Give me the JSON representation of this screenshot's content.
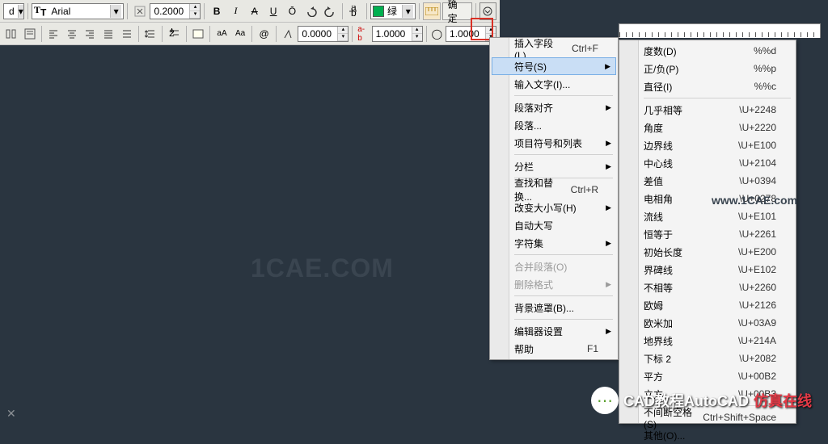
{
  "toolbar1": {
    "font_prefix": "d",
    "font": "Arial",
    "size": "0.2000",
    "bold": "B",
    "italic": "I",
    "strike": "A",
    "underline": "U",
    "overline": "Ō",
    "color_label": "绿",
    "ok": "确定"
  },
  "toolbar2": {
    "num1": "0.0000",
    "ab": "a-b",
    "num2": "1.0000",
    "num3": "1.0000"
  },
  "menu1": [
    {
      "label": "插入字段(L)...",
      "sc": "Ctrl+F"
    },
    {
      "label": "符号(S)",
      "arrow": true,
      "hl": true
    },
    {
      "label": "输入文字(I)..."
    },
    {
      "sep": true
    },
    {
      "label": "段落对齐",
      "arrow": true
    },
    {
      "label": "段落..."
    },
    {
      "label": "项目符号和列表",
      "arrow": true
    },
    {
      "sep": true
    },
    {
      "label": "分栏",
      "arrow": true
    },
    {
      "sep": true
    },
    {
      "label": "查找和替换...",
      "sc": "Ctrl+R"
    },
    {
      "label": "改变大小写(H)",
      "arrow": true
    },
    {
      "label": "自动大写"
    },
    {
      "label": "字符集",
      "arrow": true
    },
    {
      "sep": true
    },
    {
      "label": "合并段落(O)",
      "disabled": true
    },
    {
      "label": "删除格式",
      "arrow": true,
      "disabled": true
    },
    {
      "sep": true
    },
    {
      "label": "背景遮罩(B)..."
    },
    {
      "sep": true
    },
    {
      "label": "编辑器设置",
      "arrow": true
    },
    {
      "label": "帮助",
      "sc": "F1"
    }
  ],
  "menu2": [
    {
      "label": "度数(D)",
      "sc": "%%d"
    },
    {
      "label": "正/负(P)",
      "sc": "%%p"
    },
    {
      "label": "直径(I)",
      "sc": "%%c"
    },
    {
      "sep": true
    },
    {
      "label": "几乎相等",
      "sc": "\\U+2248"
    },
    {
      "label": "角度",
      "sc": "\\U+2220"
    },
    {
      "label": "边界线",
      "sc": "\\U+E100"
    },
    {
      "label": "中心线",
      "sc": "\\U+2104"
    },
    {
      "label": "差值",
      "sc": "\\U+0394"
    },
    {
      "label": "电相角",
      "sc": "\\U+0278"
    },
    {
      "label": "流线",
      "sc": "\\U+E101"
    },
    {
      "label": "恒等于",
      "sc": "\\U+2261"
    },
    {
      "label": "初始长度",
      "sc": "\\U+E200"
    },
    {
      "label": "界碑线",
      "sc": "\\U+E102"
    },
    {
      "label": "不相等",
      "sc": "\\U+2260"
    },
    {
      "label": "欧姆",
      "sc": "\\U+2126"
    },
    {
      "label": "欧米加",
      "sc": "\\U+03A9"
    },
    {
      "label": "地界线",
      "sc": "\\U+214A"
    },
    {
      "label": "下标 2",
      "sc": "\\U+2082"
    },
    {
      "label": "平方",
      "sc": "\\U+00B2"
    },
    {
      "label": "立方",
      "sc": "\\U+00B3"
    },
    {
      "sep": true
    },
    {
      "label": "不间断空格(S)",
      "sc": "Ctrl+Shift+Space"
    },
    {
      "label": "其他(O)..."
    }
  ],
  "watermark1": "1CAE.COM",
  "watermark2": "www.1CAE.com",
  "footer": {
    "t1": "CAD教程AutoCAD",
    "t2": "仿真在线"
  }
}
